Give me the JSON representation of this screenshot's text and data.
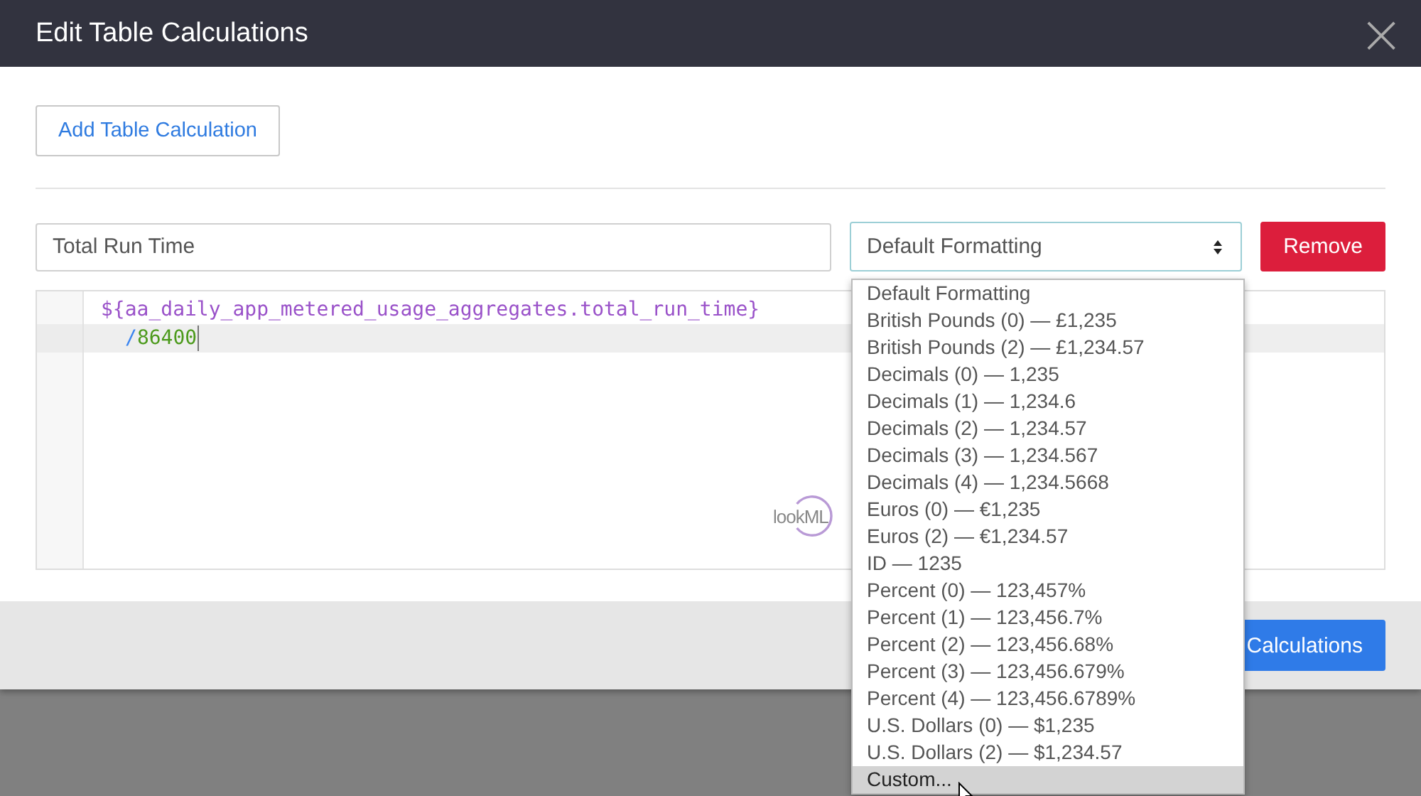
{
  "dialog": {
    "title": "Edit Table Calculations",
    "close": "×"
  },
  "add_button": "Add Table Calculation",
  "calculation": {
    "name_value": "Total Run Time",
    "format_value": "Default Formatting",
    "remove_button": "Remove",
    "code_lines": [
      {
        "active": false,
        "tokens": [
          {
            "kind": "field",
            "text": "${aa_daily_app_metered_usage_aggregates.total_run_time}"
          }
        ]
      },
      {
        "active": true,
        "tokens": [
          {
            "kind": "operator",
            "text": "/"
          },
          {
            "kind": "number",
            "text": "86400"
          }
        ]
      }
    ],
    "logo": "lookML"
  },
  "footer": {
    "primary_button": "Calculations"
  },
  "format_menu": [
    {
      "label": "Default Formatting",
      "selected": false
    },
    {
      "label": "British Pounds (0) — £1,235",
      "selected": false
    },
    {
      "label": "British Pounds (2) — £1,234.57",
      "selected": false
    },
    {
      "label": "Decimals (0) — 1,235",
      "selected": false
    },
    {
      "label": "Decimals (1) — 1,234.6",
      "selected": false
    },
    {
      "label": "Decimals (2) — 1,234.57",
      "selected": false
    },
    {
      "label": "Decimals (3) — 1,234.567",
      "selected": false
    },
    {
      "label": "Decimals (4) — 1,234.5668",
      "selected": false
    },
    {
      "label": "Euros (0) — €1,235",
      "selected": false
    },
    {
      "label": "Euros (2) — €1,234.57",
      "selected": false
    },
    {
      "label": "ID — 1235",
      "selected": false
    },
    {
      "label": "Percent (0) — 123,457%",
      "selected": false
    },
    {
      "label": "Percent (1) — 123,456.7%",
      "selected": false
    },
    {
      "label": "Percent (2) — 123,456.68%",
      "selected": false
    },
    {
      "label": "Percent (3) — 123,456.679%",
      "selected": false
    },
    {
      "label": "Percent (4) — 123,456.6789%",
      "selected": false
    },
    {
      "label": "U.S. Dollars (0) — $1,235",
      "selected": false
    },
    {
      "label": "U.S. Dollars (2) — $1,234.57",
      "selected": false
    },
    {
      "label": "Custom...",
      "selected": true
    }
  ]
}
